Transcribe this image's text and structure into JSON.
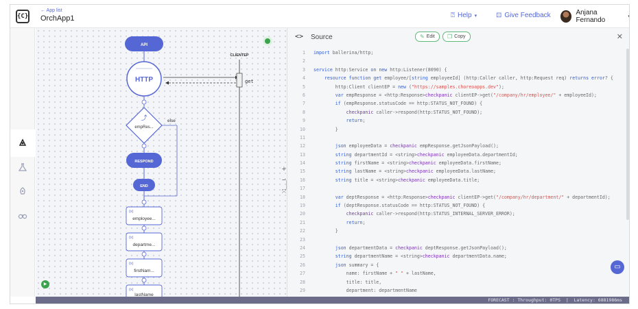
{
  "header": {
    "back_link": "← App list",
    "app_title": "OrchApp1",
    "help": "Help",
    "feedback": "Give Feedback",
    "user_name": "Anjana Fernando"
  },
  "diagram": {
    "api": "API",
    "http": "HTTP",
    "client_label": "CLIENTEP",
    "get": "get",
    "condition": "empRes...",
    "else_label": "else",
    "respond": "RESPOND",
    "end": "END",
    "var_tag": "(x)",
    "vars": [
      "employee...",
      "departme...",
      "firstNam...",
      "lastName"
    ]
  },
  "source": {
    "title": "Source",
    "edit": "Edit",
    "copy": "Copy",
    "lines": [
      {
        "n": "1",
        "t": "import ballerina/http;"
      },
      {
        "n": "2",
        "t": ""
      },
      {
        "n": "3",
        "t": "service http:Service on new http:Listener(8090) {"
      },
      {
        "n": "4",
        "t": "    resource function get employee/[string employeeId] (http:Caller caller, http:Request req) returns error? {"
      },
      {
        "n": "5",
        "t": "        http:Client clientEP = new (\"https://samples.choreoapps.dev\");"
      },
      {
        "n": "6",
        "t": "        var empResponse = <http:Response>checkpanic clientEP->get(\"/company/hr/employee/\" + employeeId);"
      },
      {
        "n": "7",
        "t": "        if (empResponse.statusCode == http:STATUS_NOT_FOUND) {"
      },
      {
        "n": "8",
        "t": "            checkpanic caller->respond(http:STATUS_NOT_FOUND);"
      },
      {
        "n": "9",
        "t": "            return;"
      },
      {
        "n": "10",
        "t": "        }"
      },
      {
        "n": "11",
        "t": ""
      },
      {
        "n": "12",
        "t": "        json employeeData = checkpanic empResponse.getJsonPayload();"
      },
      {
        "n": "13",
        "t": "        string departmentId = <string>checkpanic employeeData.departmentId;"
      },
      {
        "n": "14",
        "t": "        string firstName = <string>checkpanic employeeData.firstName;"
      },
      {
        "n": "15",
        "t": "        string lastName = <string>checkpanic employeeData.lastName;"
      },
      {
        "n": "16",
        "t": "        string title = <string>checkpanic employeeData.title;"
      },
      {
        "n": "17",
        "t": ""
      },
      {
        "n": "18",
        "t": "        var deptResponse = <http:Response>checkpanic clientEP->get(\"/company/hr/department/\" + departmentId);"
      },
      {
        "n": "19",
        "t": "        if (deptResponse.statusCode == http:STATUS_NOT_FOUND) {"
      },
      {
        "n": "20",
        "t": "            checkpanic caller->respond(http:STATUS_INTERNAL_SERVER_ERROR);"
      },
      {
        "n": "21",
        "t": "            return;"
      },
      {
        "n": "22",
        "t": "        }"
      },
      {
        "n": "23",
        "t": ""
      },
      {
        "n": "24",
        "t": "        json departmentData = checkpanic deptResponse.getJsonPayload();"
      },
      {
        "n": "25",
        "t": "        string departmentName = <string>checkpanic departmentData.name;"
      },
      {
        "n": "26",
        "t": "        json summary = {"
      },
      {
        "n": "27",
        "t": "            name: firstName + \" \" + lastName,"
      },
      {
        "n": "28",
        "t": "            title: title,"
      },
      {
        "n": "29",
        "t": "            department: departmentName"
      }
    ]
  },
  "footer": {
    "forecast": "FORECAST : Throughput: 0TPS  |  Latency: 6881986ms"
  },
  "colors": {
    "accent": "#5567d5",
    "green": "#3aa34d",
    "keyword": "#2f5fd9",
    "string": "#d9534f",
    "footer_bg": "#6a6c8a"
  },
  "icons": {
    "rail": [
      "flow-icon",
      "beaker-icon",
      "rocket-icon",
      "binoculars-icon"
    ]
  }
}
